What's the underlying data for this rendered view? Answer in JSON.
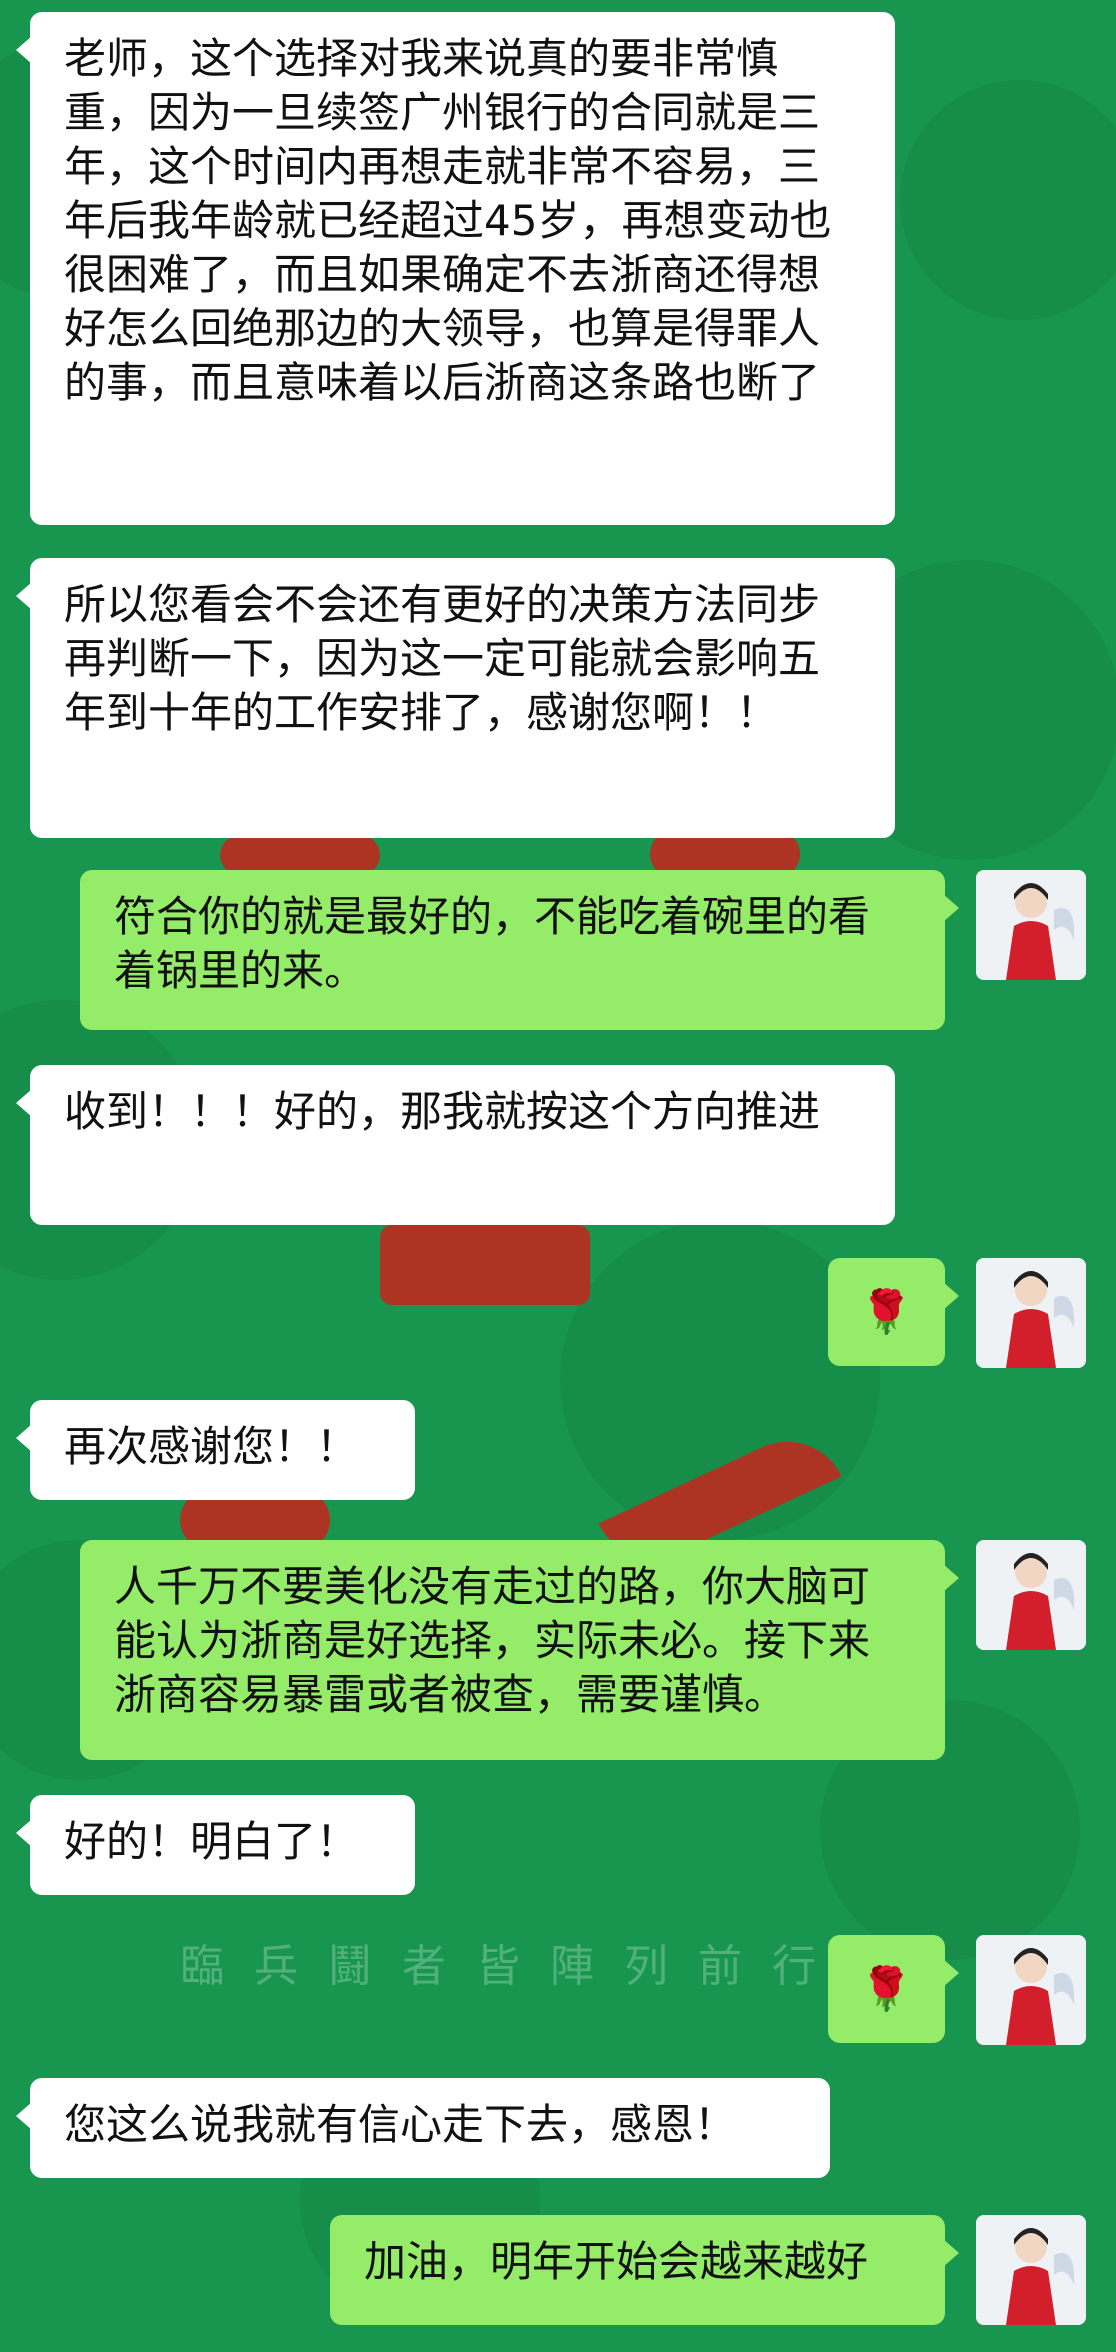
{
  "app": {
    "name": "WeChat chat"
  },
  "background": {
    "primary_color": "#18964f",
    "calligraphy_text": "臨兵鬪者皆陣列前行"
  },
  "colors": {
    "incoming_bubble": "#ffffff",
    "outgoing_bubble": "#95ec69",
    "text": "#111111"
  },
  "messages": [
    {
      "sender": "other",
      "text": "老师，这个选择对我来说真的要非常慎重，因为一旦续签广州银行的合同就是三年，这个时间内再想走就非常不容易，三年后我年龄就已经超过45岁，再想变动也很困难了，而且如果确定不去浙商还得想好怎么回绝那边的大领导，也算是得罪人的事，而且意味着以后浙商这条路也断了"
    },
    {
      "sender": "other",
      "text": "所以您看会不会还有更好的决策方法同步再判断一下，因为这一定可能就会影响五年到十年的工作安排了，感谢您啊！！"
    },
    {
      "sender": "me",
      "text": "符合你的就是最好的，不能吃着碗里的看着锅里的来。"
    },
    {
      "sender": "other",
      "text": "收到！！！好的，那我就按这个方向推进"
    },
    {
      "sender": "me",
      "text": "🌹",
      "icon": "rose-icon"
    },
    {
      "sender": "other",
      "text": "再次感谢您！！"
    },
    {
      "sender": "me",
      "text": "人千万不要美化没有走过的路，你大脑可能认为浙商是好选择，实际未必。接下来浙商容易暴雷或者被查，需要谨慎。"
    },
    {
      "sender": "other",
      "text": "好的！明白了！"
    },
    {
      "sender": "me",
      "text": "🌹",
      "icon": "rose-icon"
    },
    {
      "sender": "other",
      "text": "您这么说我就有信心走下去，感恩！"
    },
    {
      "sender": "me",
      "text": "加油，明年开始会越来越好"
    }
  ]
}
